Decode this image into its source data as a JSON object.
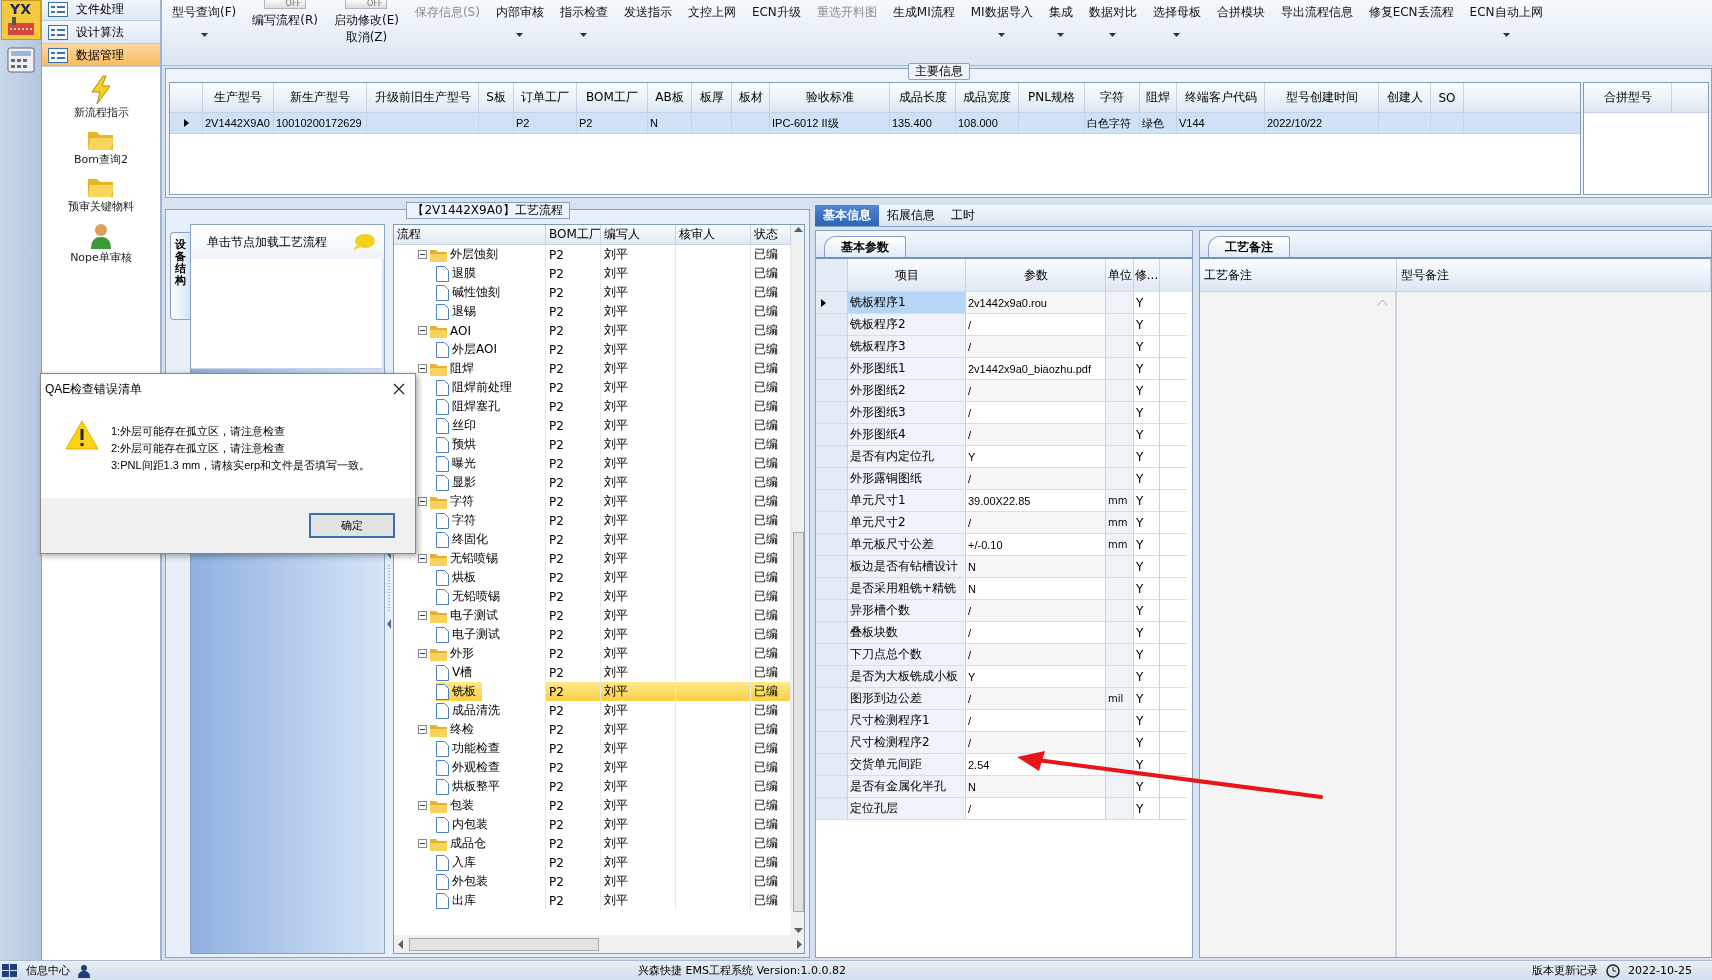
{
  "app": {
    "logo_text": "YX"
  },
  "nav": {
    "menu": [
      {
        "label": "文件处理",
        "selected": false
      },
      {
        "label": "设计算法",
        "selected": false
      },
      {
        "label": "数据管理",
        "selected": true
      }
    ],
    "tools": [
      {
        "label": "新流程指示",
        "kind": "lightning"
      },
      {
        "label": "Bom查询2",
        "kind": "folder"
      },
      {
        "label": "预审关键物料",
        "kind": "folder"
      },
      {
        "label": "Nope单审核",
        "kind": "user"
      }
    ]
  },
  "toolbar": [
    {
      "label": "型号查询(F)",
      "kind": "dropdown",
      "disabled": false
    },
    {
      "label": "编写流程(R)",
      "kind": "switch",
      "switch_text": "OFF",
      "disabled": false
    },
    {
      "label": "启动修改(E)",
      "second_label": "取消(Z)",
      "kind": "switch",
      "switch_text": "OFF",
      "disabled": false
    },
    {
      "label": "保存信息(S)",
      "kind": "plain",
      "disabled": true
    },
    {
      "label": "内部审核",
      "kind": "dropdown",
      "disabled": false
    },
    {
      "label": "指示检查",
      "kind": "dropdown",
      "disabled": false
    },
    {
      "label": "发送指示",
      "kind": "plain",
      "disabled": false
    },
    {
      "label": "文控上网",
      "kind": "plain",
      "disabled": false
    },
    {
      "label": "ECN升级",
      "kind": "plain",
      "disabled": false
    },
    {
      "label": "重选开料图",
      "kind": "plain",
      "disabled": true
    },
    {
      "label": "生成MI流程",
      "kind": "plain",
      "disabled": false
    },
    {
      "label": "MI数据导入",
      "kind": "dropdown",
      "disabled": false
    },
    {
      "label": "集成",
      "kind": "dropdown",
      "disabled": false
    },
    {
      "label": "数据对比",
      "kind": "dropdown",
      "disabled": false
    },
    {
      "label": "选择母板",
      "kind": "dropdown",
      "disabled": false
    },
    {
      "label": "合拼模块",
      "kind": "plain",
      "disabled": false
    },
    {
      "label": "导出流程信息",
      "kind": "plain",
      "disabled": false
    },
    {
      "label": "修复ECN丢流程",
      "kind": "plain",
      "disabled": false
    },
    {
      "label": "ECN自动上网",
      "kind": "dropdown",
      "disabled": false
    }
  ],
  "main_info": {
    "title": "主要信息",
    "columns": [
      "生产型号",
      "新生产型号",
      "升级前旧生产型号",
      "S板",
      "订单工厂",
      "BOM工厂",
      "AB板",
      "板厚",
      "板材",
      "验收标准",
      "成品长度",
      "成品宽度",
      "PNL规格",
      "字符",
      "阻焊",
      "终端客户代码",
      "型号创建时间",
      "创建人",
      "SO"
    ],
    "rows": [
      {
        "selected": true,
        "cells": [
          "2V1442X9A0",
          "10010200172629",
          null,
          null,
          "P2",
          "P2",
          "N",
          null,
          null,
          "IPC-6012 II级",
          "135.400",
          "108.000",
          null,
          "白色字符",
          "绿色",
          "V144",
          "2022/10/22",
          null,
          null
        ]
      }
    ],
    "side_columns": [
      "合拼型号"
    ]
  },
  "flow": {
    "title": "【2V1442X9A0】工艺流程",
    "side_tab": "设备结构",
    "list_header": "单击节点加载工艺流程",
    "columns": [
      "流程",
      "BOM工厂",
      "编写人",
      "核审人",
      "状态"
    ],
    "tree": [
      {
        "name": "外层蚀刻",
        "bom": "P2",
        "writer": "刘平",
        "status": "已编",
        "expanded": true,
        "selected": false,
        "children": [
          {
            "name": "退膜",
            "bom": "P2",
            "writer": "刘平",
            "status": "已编",
            "selected": false
          },
          {
            "name": "碱性蚀刻",
            "bom": "P2",
            "writer": "刘平",
            "status": "已编",
            "selected": false
          },
          {
            "name": "退锡",
            "bom": "P2",
            "writer": "刘平",
            "status": "已编",
            "selected": false
          }
        ]
      },
      {
        "name": "AOI",
        "bom": "P2",
        "writer": "刘平",
        "status": "已编",
        "expanded": true,
        "selected": false,
        "children": [
          {
            "name": "外层AOI",
            "bom": "P2",
            "writer": "刘平",
            "status": "已编",
            "selected": false
          }
        ]
      },
      {
        "name": "阻焊",
        "bom": "P2",
        "writer": "刘平",
        "status": "已编",
        "expanded": true,
        "selected": false,
        "children": [
          {
            "name": "阻焊前处理",
            "bom": "P2",
            "writer": "刘平",
            "status": "已编",
            "selected": false
          },
          {
            "name": "阻焊塞孔",
            "bom": "P2",
            "writer": "刘平",
            "status": "已编",
            "selected": false
          },
          {
            "name": "丝印",
            "bom": "P2",
            "writer": "刘平",
            "status": "已编",
            "selected": false
          },
          {
            "name": "预烘",
            "bom": "P2",
            "writer": "刘平",
            "status": "已编",
            "selected": false
          },
          {
            "name": "曝光",
            "bom": "P2",
            "writer": "刘平",
            "status": "已编",
            "selected": false
          },
          {
            "name": "显影",
            "bom": "P2",
            "writer": "刘平",
            "status": "已编",
            "selected": false
          }
        ]
      },
      {
        "name": "字符",
        "bom": "P2",
        "writer": "刘平",
        "status": "已编",
        "expanded": true,
        "selected": false,
        "children": [
          {
            "name": "字符",
            "bom": "P2",
            "writer": "刘平",
            "status": "已编",
            "selected": false
          },
          {
            "name": "终固化",
            "bom": "P2",
            "writer": "刘平",
            "status": "已编",
            "selected": false
          }
        ]
      },
      {
        "name": "无铅喷锡",
        "bom": "P2",
        "writer": "刘平",
        "status": "已编",
        "expanded": true,
        "selected": false,
        "children": [
          {
            "name": "烘板",
            "bom": "P2",
            "writer": "刘平",
            "status": "已编",
            "selected": false
          },
          {
            "name": "无铅喷锡",
            "bom": "P2",
            "writer": "刘平",
            "status": "已编",
            "selected": false
          }
        ]
      },
      {
        "name": "电子测试",
        "bom": "P2",
        "writer": "刘平",
        "status": "已编",
        "expanded": true,
        "selected": false,
        "children": [
          {
            "name": "电子测试",
            "bom": "P2",
            "writer": "刘平",
            "status": "已编",
            "selected": false
          }
        ]
      },
      {
        "name": "外形",
        "bom": "P2",
        "writer": "刘平",
        "status": "已编",
        "expanded": true,
        "selected": false,
        "children": [
          {
            "name": "V槽",
            "bom": "P2",
            "writer": "刘平",
            "status": "已编",
            "selected": false
          },
          {
            "name": "铣板",
            "bom": "P2",
            "writer": "刘平",
            "status": "已编",
            "selected": true
          },
          {
            "name": "成品清洗",
            "bom": "P2",
            "writer": "刘平",
            "status": "已编",
            "selected": false
          }
        ]
      },
      {
        "name": "终检",
        "bom": "P2",
        "writer": "刘平",
        "status": "已编",
        "expanded": true,
        "selected": false,
        "children": [
          {
            "name": "功能检查",
            "bom": "P2",
            "writer": "刘平",
            "status": "已编",
            "selected": false
          },
          {
            "name": "外观检查",
            "bom": "P2",
            "writer": "刘平",
            "status": "已编",
            "selected": false
          },
          {
            "name": "烘板整平",
            "bom": "P2",
            "writer": "刘平",
            "status": "已编",
            "selected": false
          }
        ]
      },
      {
        "name": "包装",
        "bom": "P2",
        "writer": "刘平",
        "status": "已编",
        "expanded": true,
        "selected": false,
        "children": [
          {
            "name": "内包装",
            "bom": "P2",
            "writer": "刘平",
            "status": "已编",
            "selected": false
          }
        ]
      },
      {
        "name": "成品仓",
        "bom": "P2",
        "writer": "刘平",
        "status": "已编",
        "expanded": true,
        "selected": false,
        "children": [
          {
            "name": "入库",
            "bom": "P2",
            "writer": "刘平",
            "status": "已编",
            "selected": false
          },
          {
            "name": "外包装",
            "bom": "P2",
            "writer": "刘平",
            "status": "已编",
            "selected": false
          },
          {
            "name": "出库",
            "bom": "P2",
            "writer": "刘平",
            "status": "已编",
            "selected": false
          }
        ]
      }
    ]
  },
  "details": {
    "tabs": [
      {
        "label": "基本信息",
        "selected": true
      },
      {
        "label": "拓展信息",
        "selected": false
      },
      {
        "label": "工时",
        "selected": false
      }
    ],
    "params": {
      "tab": "基本参数",
      "columns": [
        "项目",
        "参数",
        "单位",
        "修..."
      ],
      "rows": [
        {
          "item": "铣板程序1",
          "value": "2v1442x9a0.rou",
          "flag": "Y",
          "selected": true
        },
        {
          "item": "铣板程序2",
          "value": "/",
          "flag": "Y",
          "selected": false
        },
        {
          "item": "铣板程序3",
          "value": "/",
          "flag": "Y",
          "selected": false
        },
        {
          "item": "外形图纸1",
          "value": "2v1442x9a0_biaozhu.pdf",
          "flag": "Y",
          "selected": false
        },
        {
          "item": "外形图纸2",
          "value": "/",
          "flag": "Y",
          "selected": false
        },
        {
          "item": "外形图纸3",
          "value": "/",
          "flag": "Y",
          "selected": false
        },
        {
          "item": "外形图纸4",
          "value": "/",
          "flag": "Y",
          "selected": false
        },
        {
          "item": "是否有内定位孔",
          "value": "Y",
          "flag": "Y",
          "selected": false
        },
        {
          "item": "外形露铜图纸",
          "value": "/",
          "flag": "Y",
          "selected": false
        },
        {
          "item": "单元尺寸1",
          "value": "39.00X22.85",
          "unit": "mm",
          "flag": "Y",
          "selected": false
        },
        {
          "item": "单元尺寸2",
          "value": "/",
          "unit": "mm",
          "flag": "Y",
          "selected": false
        },
        {
          "item": "单元板尺寸公差",
          "value": "+/-0.10",
          "unit": "mm",
          "flag": "Y",
          "selected": false
        },
        {
          "item": "板边是否有钻槽设计",
          "value": "N",
          "flag": "Y",
          "selected": false
        },
        {
          "item": "是否采用粗铣+精铣",
          "value": "N",
          "flag": "Y",
          "selected": false
        },
        {
          "item": "异形槽个数",
          "value": "/",
          "flag": "Y",
          "selected": false
        },
        {
          "item": "叠板块数",
          "value": "/",
          "flag": "Y",
          "selected": false
        },
        {
          "item": "下刀点总个数",
          "value": "/",
          "flag": "Y",
          "selected": false
        },
        {
          "item": "是否为大板铣成小板",
          "value": "Y",
          "flag": "Y",
          "selected": false
        },
        {
          "item": "图形到边公差",
          "value": "/",
          "unit": "mil",
          "flag": "Y",
          "selected": false
        },
        {
          "item": "尺寸检测程序1",
          "value": "/",
          "flag": "Y",
          "selected": false
        },
        {
          "item": "尺寸检测程序2",
          "value": "/",
          "flag": "Y",
          "selected": false
        },
        {
          "item": "交货单元间距",
          "value": "2.54",
          "flag": "Y",
          "selected": false
        },
        {
          "item": "是否有金属化半孔",
          "value": "N",
          "flag": "Y",
          "selected": false
        },
        {
          "item": "定位孔层",
          "value": "/",
          "flag": "Y",
          "selected": false
        }
      ]
    },
    "memo": {
      "tab": "工艺备注",
      "columns": [
        "工艺备注",
        "型号备注"
      ]
    }
  },
  "dialog": {
    "title": "QAE检查错误清单",
    "messages": [
      "1:外层可能存在孤立区，请注意检查",
      "2:外层可能存在孤立区，请注意检查",
      "3:PNL间距1.3 mm，请核实erp和文件是否填写一致。"
    ],
    "ok_label": "确定"
  },
  "status_bar": {
    "info_center": "信息中心",
    "system": "兴森快捷 EMS工程系统 Version:1.0.0.82",
    "version_log": "版本更新记录",
    "date": "2022-10-25"
  }
}
